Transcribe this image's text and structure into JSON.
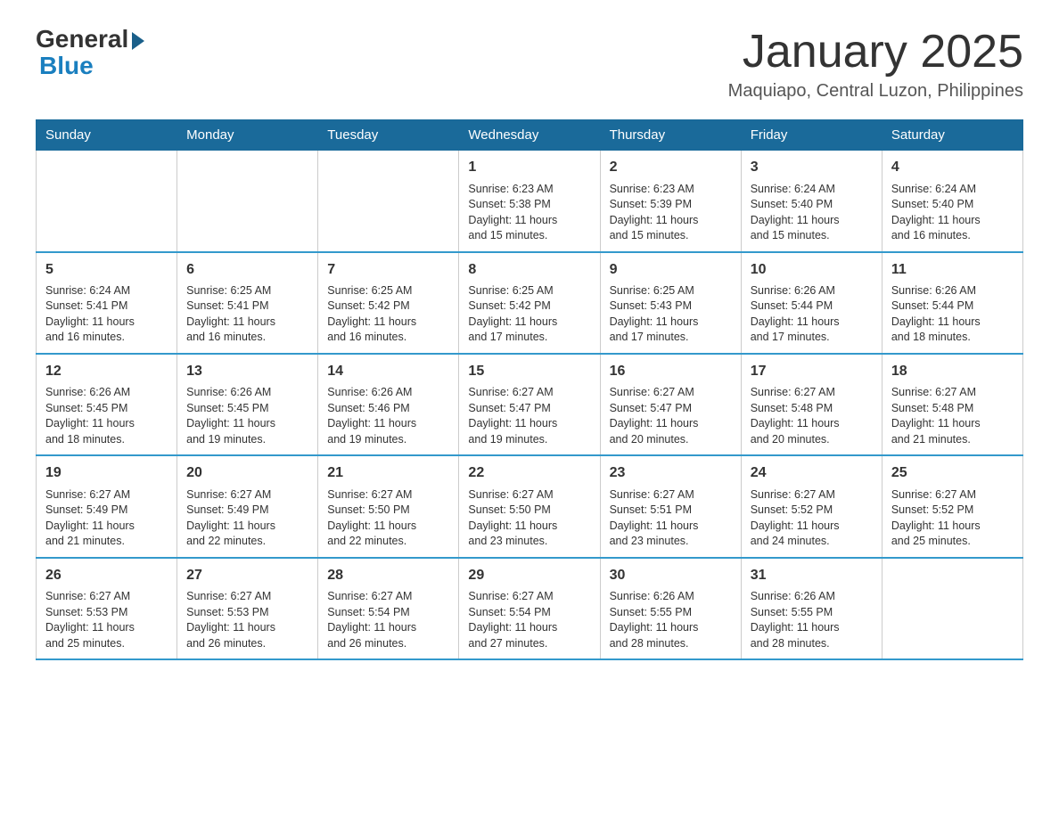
{
  "header": {
    "logo_general": "General",
    "logo_blue": "Blue",
    "month_title": "January 2025",
    "location": "Maquiapo, Central Luzon, Philippines"
  },
  "calendar": {
    "days_of_week": [
      "Sunday",
      "Monday",
      "Tuesday",
      "Wednesday",
      "Thursday",
      "Friday",
      "Saturday"
    ],
    "weeks": [
      [
        {
          "day": "",
          "info": ""
        },
        {
          "day": "",
          "info": ""
        },
        {
          "day": "",
          "info": ""
        },
        {
          "day": "1",
          "info": "Sunrise: 6:23 AM\nSunset: 5:38 PM\nDaylight: 11 hours\nand 15 minutes."
        },
        {
          "day": "2",
          "info": "Sunrise: 6:23 AM\nSunset: 5:39 PM\nDaylight: 11 hours\nand 15 minutes."
        },
        {
          "day": "3",
          "info": "Sunrise: 6:24 AM\nSunset: 5:40 PM\nDaylight: 11 hours\nand 15 minutes."
        },
        {
          "day": "4",
          "info": "Sunrise: 6:24 AM\nSunset: 5:40 PM\nDaylight: 11 hours\nand 16 minutes."
        }
      ],
      [
        {
          "day": "5",
          "info": "Sunrise: 6:24 AM\nSunset: 5:41 PM\nDaylight: 11 hours\nand 16 minutes."
        },
        {
          "day": "6",
          "info": "Sunrise: 6:25 AM\nSunset: 5:41 PM\nDaylight: 11 hours\nand 16 minutes."
        },
        {
          "day": "7",
          "info": "Sunrise: 6:25 AM\nSunset: 5:42 PM\nDaylight: 11 hours\nand 16 minutes."
        },
        {
          "day": "8",
          "info": "Sunrise: 6:25 AM\nSunset: 5:42 PM\nDaylight: 11 hours\nand 17 minutes."
        },
        {
          "day": "9",
          "info": "Sunrise: 6:25 AM\nSunset: 5:43 PM\nDaylight: 11 hours\nand 17 minutes."
        },
        {
          "day": "10",
          "info": "Sunrise: 6:26 AM\nSunset: 5:44 PM\nDaylight: 11 hours\nand 17 minutes."
        },
        {
          "day": "11",
          "info": "Sunrise: 6:26 AM\nSunset: 5:44 PM\nDaylight: 11 hours\nand 18 minutes."
        }
      ],
      [
        {
          "day": "12",
          "info": "Sunrise: 6:26 AM\nSunset: 5:45 PM\nDaylight: 11 hours\nand 18 minutes."
        },
        {
          "day": "13",
          "info": "Sunrise: 6:26 AM\nSunset: 5:45 PM\nDaylight: 11 hours\nand 19 minutes."
        },
        {
          "day": "14",
          "info": "Sunrise: 6:26 AM\nSunset: 5:46 PM\nDaylight: 11 hours\nand 19 minutes."
        },
        {
          "day": "15",
          "info": "Sunrise: 6:27 AM\nSunset: 5:47 PM\nDaylight: 11 hours\nand 19 minutes."
        },
        {
          "day": "16",
          "info": "Sunrise: 6:27 AM\nSunset: 5:47 PM\nDaylight: 11 hours\nand 20 minutes."
        },
        {
          "day": "17",
          "info": "Sunrise: 6:27 AM\nSunset: 5:48 PM\nDaylight: 11 hours\nand 20 minutes."
        },
        {
          "day": "18",
          "info": "Sunrise: 6:27 AM\nSunset: 5:48 PM\nDaylight: 11 hours\nand 21 minutes."
        }
      ],
      [
        {
          "day": "19",
          "info": "Sunrise: 6:27 AM\nSunset: 5:49 PM\nDaylight: 11 hours\nand 21 minutes."
        },
        {
          "day": "20",
          "info": "Sunrise: 6:27 AM\nSunset: 5:49 PM\nDaylight: 11 hours\nand 22 minutes."
        },
        {
          "day": "21",
          "info": "Sunrise: 6:27 AM\nSunset: 5:50 PM\nDaylight: 11 hours\nand 22 minutes."
        },
        {
          "day": "22",
          "info": "Sunrise: 6:27 AM\nSunset: 5:50 PM\nDaylight: 11 hours\nand 23 minutes."
        },
        {
          "day": "23",
          "info": "Sunrise: 6:27 AM\nSunset: 5:51 PM\nDaylight: 11 hours\nand 23 minutes."
        },
        {
          "day": "24",
          "info": "Sunrise: 6:27 AM\nSunset: 5:52 PM\nDaylight: 11 hours\nand 24 minutes."
        },
        {
          "day": "25",
          "info": "Sunrise: 6:27 AM\nSunset: 5:52 PM\nDaylight: 11 hours\nand 25 minutes."
        }
      ],
      [
        {
          "day": "26",
          "info": "Sunrise: 6:27 AM\nSunset: 5:53 PM\nDaylight: 11 hours\nand 25 minutes."
        },
        {
          "day": "27",
          "info": "Sunrise: 6:27 AM\nSunset: 5:53 PM\nDaylight: 11 hours\nand 26 minutes."
        },
        {
          "day": "28",
          "info": "Sunrise: 6:27 AM\nSunset: 5:54 PM\nDaylight: 11 hours\nand 26 minutes."
        },
        {
          "day": "29",
          "info": "Sunrise: 6:27 AM\nSunset: 5:54 PM\nDaylight: 11 hours\nand 27 minutes."
        },
        {
          "day": "30",
          "info": "Sunrise: 6:26 AM\nSunset: 5:55 PM\nDaylight: 11 hours\nand 28 minutes."
        },
        {
          "day": "31",
          "info": "Sunrise: 6:26 AM\nSunset: 5:55 PM\nDaylight: 11 hours\nand 28 minutes."
        },
        {
          "day": "",
          "info": ""
        }
      ]
    ]
  }
}
